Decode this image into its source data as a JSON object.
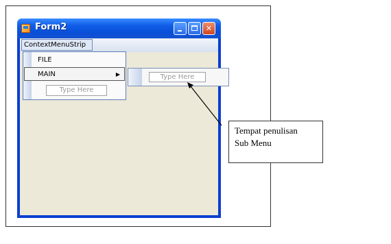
{
  "window": {
    "title": "Form2",
    "min_label": "_",
    "close_label": "✕"
  },
  "menustrip": {
    "label": "ContextMenuStrip"
  },
  "dropdown": {
    "items": [
      {
        "label": "FILE"
      },
      {
        "label": "MAIN",
        "arrow": "▶"
      }
    ],
    "type_here": "Type Here"
  },
  "submenu": {
    "type_here": "Type Here"
  },
  "callout": {
    "line1": "Tempat penulisan",
    "line2": "Sub Menu"
  }
}
